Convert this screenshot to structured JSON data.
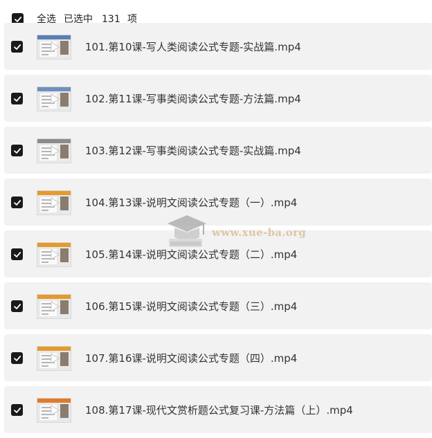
{
  "header": {
    "select_all": "全选",
    "selected_label": "已选中",
    "selected_count": "131",
    "count_unit": "项"
  },
  "files": [
    {
      "name": "101.第10课-写人类阅读公式专题-实战篇.mp4",
      "thumb_accent": "#5a7fb3"
    },
    {
      "name": "102.第11课-写事类阅读公式专题-方法篇.mp4",
      "thumb_accent": "#6f8fbf"
    },
    {
      "name": "103.第12课-写事类阅读公式专题-实战篇.mp4",
      "thumb_accent": "#8c8c8c"
    },
    {
      "name": "104.第13课-说明文阅读公式专题（一）.mp4",
      "thumb_accent": "#e59a2f"
    },
    {
      "name": "105.第14课-说明文阅读公式专题（二）.mp4",
      "thumb_accent": "#e59a2f"
    },
    {
      "name": "106.第15课-说明文阅读公式专题（三）.mp4",
      "thumb_accent": "#e59a2f"
    },
    {
      "name": "107.第16课-说明文阅读公式专题（四）.mp4",
      "thumb_accent": "#e59a2f"
    },
    {
      "name": "108.第17课-现代文赏析题公式复习课-方法篇（上）.mp4",
      "thumb_accent": "#e07b2a"
    }
  ],
  "watermark": {
    "text": "www.xue-ba.org"
  }
}
